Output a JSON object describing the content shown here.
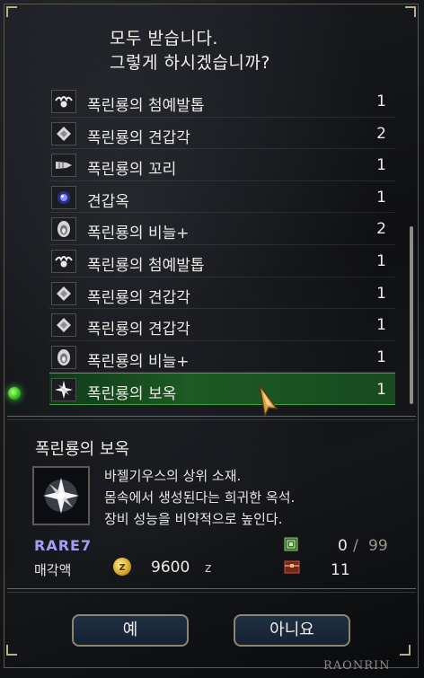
{
  "dialog": {
    "prompt_line1": "모두 받습니다.",
    "prompt_line2": "그렇게 하시겠습니까?"
  },
  "items": [
    {
      "icon": "claw-icon",
      "name": "폭린룡의 첨예발톱",
      "qty": "1"
    },
    {
      "icon": "carapace-icon",
      "name": "폭린룡의 견갑각",
      "qty": "2"
    },
    {
      "icon": "tail-icon",
      "name": "폭린룡의 꼬리",
      "qty": "1"
    },
    {
      "icon": "gem-icon",
      "name": "견갑옥",
      "qty": "1"
    },
    {
      "icon": "scale-icon",
      "name": "폭린룡의 비늘+",
      "qty": "2"
    },
    {
      "icon": "claw-icon",
      "name": "폭린룡의 첨예발톱",
      "qty": "1"
    },
    {
      "icon": "carapace-icon",
      "name": "폭린룡의 견갑각",
      "qty": "1"
    },
    {
      "icon": "carapace-icon",
      "name": "폭린룡의 견갑각",
      "qty": "1"
    },
    {
      "icon": "scale-icon",
      "name": "폭린룡의 비늘+",
      "qty": "1"
    },
    {
      "icon": "jewel-icon",
      "name": "폭린룡의 보옥",
      "qty": "1"
    }
  ],
  "selected_index": 9,
  "detail": {
    "title": "폭린룡의 보옥",
    "desc_line1": "바젤기우스의 상위 소재.",
    "desc_line2": "몸속에서 생성된다는 희귀한 옥석.",
    "desc_line3": "장비 성능을 비약적으로 높인다.",
    "rarity": "RARE7",
    "sell_label": "매각액",
    "price": "9600",
    "currency": "z",
    "box_owned": "0",
    "box_sep": "/",
    "box_max": "99",
    "chest_count": "11"
  },
  "buttons": {
    "yes": "예",
    "no": "아니요"
  },
  "watermark": "RAONRIN",
  "colors": {
    "selection": "#1d5a25",
    "rarity": "#a79cf4",
    "button_bg": "#1f3044",
    "frame": "#8d866f"
  }
}
